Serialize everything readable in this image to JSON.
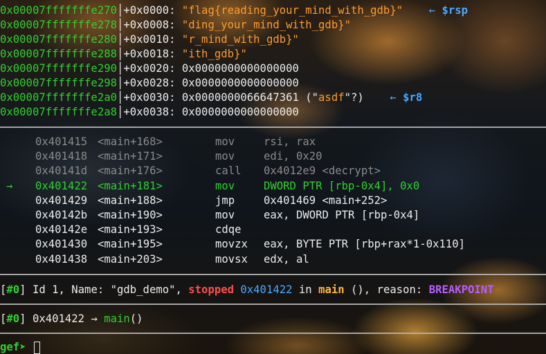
{
  "stack": [
    {
      "addr": "0x00007fffffffe270",
      "off": "+0x0000: ",
      "val_prefix": "\"",
      "val": "flag{reading_your_mind_with_gdb}",
      "val_suffix": "\"",
      "tail": "    ← ",
      "reg": "$rsp"
    },
    {
      "addr": "0x00007fffffffe278",
      "off": "+0x0008: ",
      "val_prefix": "\"",
      "val": "ding_your_mind_with_gdb}",
      "val_suffix": "\"",
      "tail": "",
      "reg": ""
    },
    {
      "addr": "0x00007fffffffe280",
      "off": "+0x0010: ",
      "val_prefix": "\"",
      "val": "r_mind_with_gdb}",
      "val_suffix": "\"",
      "tail": "",
      "reg": ""
    },
    {
      "addr": "0x00007fffffffe288",
      "off": "+0x0018: ",
      "val_prefix": "\"",
      "val": "ith_gdb}",
      "val_suffix": "\"",
      "tail": "",
      "reg": ""
    },
    {
      "addr": "0x00007fffffffe290",
      "off": "+0x0020: ",
      "plain": "0x0000000000000000"
    },
    {
      "addr": "0x00007fffffffe298",
      "off": "+0x0028: ",
      "plain": "0x0000000000000000"
    },
    {
      "addr": "0x00007fffffffe2a0",
      "off": "+0x0030: ",
      "plain": "0x0000000066647361 (\"",
      "str": "asdf",
      "plain2": "\"?)",
      "tail": "    ← ",
      "reg": "$r8"
    },
    {
      "addr": "0x00007fffffffe2a8",
      "off": "+0x0038: ",
      "plain": "0x0000000000000000"
    }
  ],
  "code": [
    {
      "marker": "",
      "addr": "0x401415",
      "sym": "<main+168>",
      "op": "mov",
      "args": "rsi, rax",
      "state": "past"
    },
    {
      "marker": "",
      "addr": "0x401418",
      "sym": "<main+171>",
      "op": "mov",
      "args": "edi, 0x20",
      "state": "past"
    },
    {
      "marker": "",
      "addr": "0x40141d",
      "sym": "<main+176>",
      "op": "call",
      "args": "0x4012e9 <decrypt>",
      "state": "past"
    },
    {
      "marker": "→",
      "addr": "0x401422",
      "sym": "<main+181>",
      "op": "mov",
      "args": "DWORD PTR [rbp-0x4], 0x0",
      "state": "current"
    },
    {
      "marker": "",
      "addr": "0x401429",
      "sym": "<main+188>",
      "op": "jmp",
      "args": "0x401469 <main+252>",
      "state": "future"
    },
    {
      "marker": "",
      "addr": "0x40142b",
      "sym": "<main+190>",
      "op": "mov",
      "args": "eax, DWORD PTR [rbp-0x4]",
      "state": "future"
    },
    {
      "marker": "",
      "addr": "0x40142e",
      "sym": "<main+193>",
      "op": "cdqe",
      "args": "",
      "state": "future"
    },
    {
      "marker": "",
      "addr": "0x401430",
      "sym": "<main+195>",
      "op": "movzx",
      "args": "eax, BYTE PTR [rbp+rax*1-0x110]",
      "state": "future"
    },
    {
      "marker": "",
      "addr": "0x401438",
      "sym": "<main+203>",
      "op": "movsx",
      "args": "edx, al",
      "state": "future"
    }
  ],
  "threads": {
    "open": "[",
    "id": "#0",
    "close": "] ",
    "text1": "Id 1, Name: \"gdb_demo\", ",
    "stopped": "stopped",
    "space": " ",
    "addr": "0x401422",
    "in": " in ",
    "func": "main",
    "text2": " (), reason: ",
    "reason": "BREAKPOINT"
  },
  "trace": {
    "open": "[",
    "id": "#0",
    "close": "] ",
    "addr": "0x401422",
    "arrow": " → ",
    "func": "main",
    "parens": "()"
  },
  "prompt": {
    "label": "gef➤ ",
    "input_value": ""
  },
  "colors": {
    "address": "#2fd02f",
    "string": "#ff9a2e",
    "register": "#4aa8ff",
    "stopped": "#ff4d4d",
    "function": "#ffb53a",
    "reason": "#b85cff"
  }
}
